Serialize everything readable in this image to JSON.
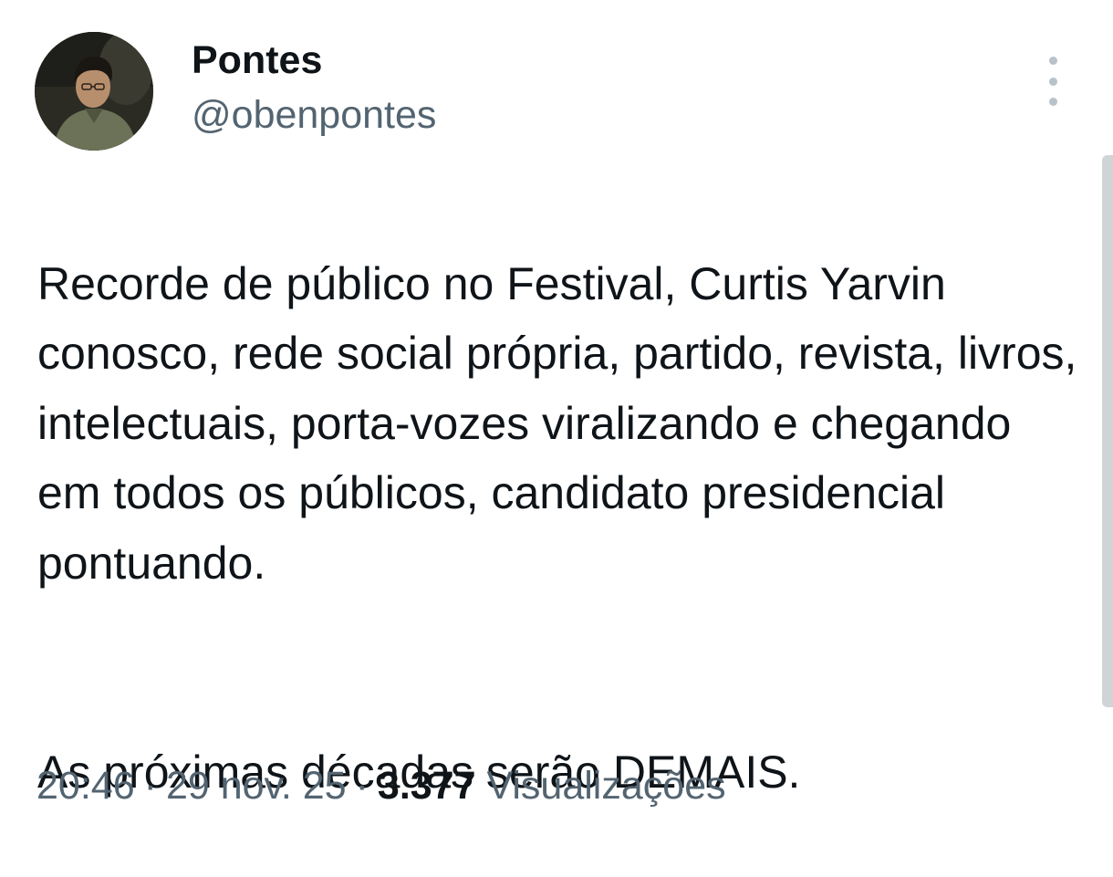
{
  "author": {
    "display_name": "Pontes",
    "handle": "@obenpontes"
  },
  "tweet": {
    "paragraphs": [
      "Recorde de público no Festival, Curtis Yarvin conosco, rede social própria, partido, revista, livros, intelectuais, porta-vozes viralizando e chegando em todos os públicos, candidato presidencial pontuando.",
      "As próximas décadas serão DEMAIS."
    ]
  },
  "meta": {
    "time": "20:46",
    "separator": "·",
    "date": "29 nov. 25",
    "views_count": "3.377",
    "views_label": "Visualizações"
  },
  "icons": {
    "more": "more-vertical-icon"
  },
  "colors": {
    "text": "#0f1419",
    "secondary": "#536471",
    "more_dots": "#b8c2c9",
    "scrollbar": "#cfd4d7",
    "background": "#ffffff"
  }
}
